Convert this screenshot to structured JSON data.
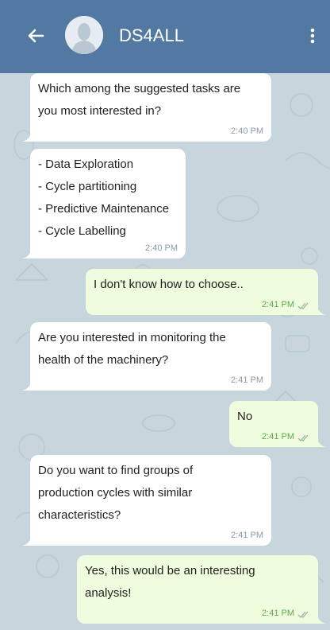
{
  "header": {
    "title": "DS4ALL",
    "back_icon": "arrow-left-icon",
    "menu_icon": "kebab-menu-icon",
    "color": "#5279a2"
  },
  "messages": [
    {
      "direction": "incoming",
      "lines": [
        "Which among the suggested tasks are",
        "you most interested in?"
      ],
      "time": "2:40 PM"
    },
    {
      "direction": "incoming",
      "lines": [
        "- Data Exploration",
        "- Cycle partitioning",
        "- Predictive Maintenance",
        "- Cycle Labelling"
      ],
      "time": "2:40 PM"
    },
    {
      "direction": "outgoing",
      "lines": [
        "I don't know how to choose.."
      ],
      "time": "2:41 PM"
    },
    {
      "direction": "incoming",
      "lines": [
        "Are you interested in monitoring the",
        "health of the machinery?"
      ],
      "time": "2:41 PM"
    },
    {
      "direction": "outgoing",
      "lines": [
        "No"
      ],
      "time": "2:41 PM"
    },
    {
      "direction": "incoming",
      "lines": [
        "Do you want to find groups of",
        "production cycles with similar",
        "characteristics?"
      ],
      "time": "2:41 PM"
    },
    {
      "direction": "outgoing",
      "lines": [
        "Yes, this would be an interesting",
        "analysis!"
      ],
      "time": "2:41 PM"
    }
  ],
  "colors": {
    "incoming_bubble": "#ffffff",
    "outgoing_bubble": "#effdde",
    "chat_background": "#c7d5dd",
    "outgoing_time": "#5ea94f"
  }
}
